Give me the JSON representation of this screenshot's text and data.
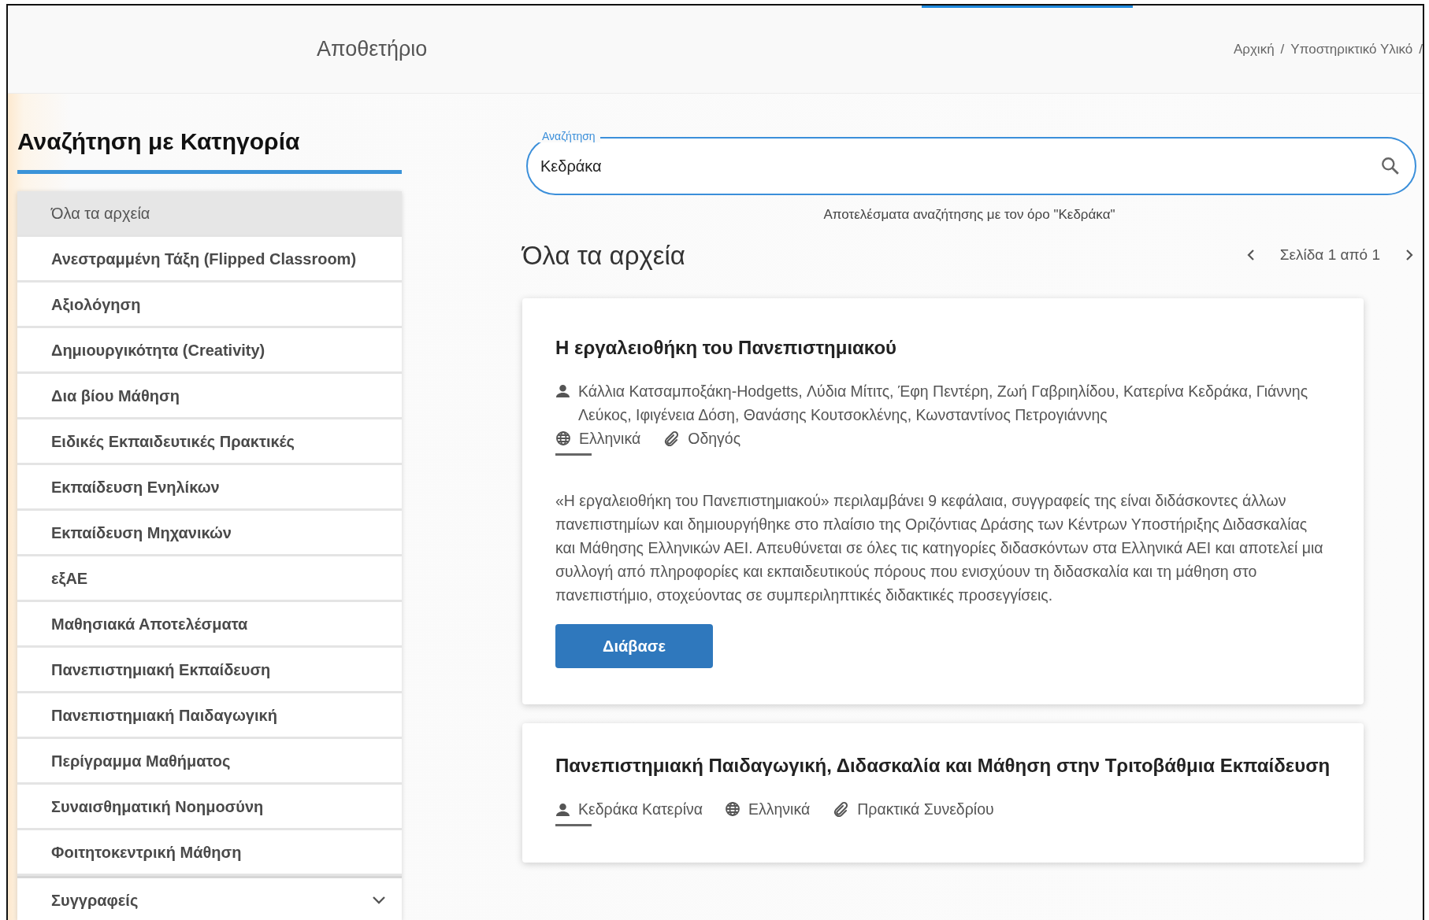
{
  "header": {
    "title": "Αποθετήριο",
    "breadcrumb": [
      {
        "label": "Αρχική",
        "separator": "/"
      },
      {
        "label": "Υποστηρικτικό Υλικό",
        "separator": "/"
      }
    ]
  },
  "sidebar": {
    "heading": "Αναζήτηση με Κατηγορία",
    "items": [
      {
        "label": "Όλα τα αρχεία",
        "selected": true
      },
      {
        "label": "Ανεστραμμένη Τάξη (Flipped Classroom)",
        "selected": false
      },
      {
        "label": "Αξιολόγηση",
        "selected": false
      },
      {
        "label": "Δημιουργικότητα (Creativity)",
        "selected": false
      },
      {
        "label": "Δια βίου Μάθηση",
        "selected": false
      },
      {
        "label": "Ειδικές Εκπαιδευτικές Πρακτικές",
        "selected": false
      },
      {
        "label": "Εκπαίδευση Ενηλίκων",
        "selected": false
      },
      {
        "label": "Εκπαίδευση Μηχανικών",
        "selected": false
      },
      {
        "label": "εξΑΕ",
        "selected": false
      },
      {
        "label": "Μαθησιακά Αποτελέσματα",
        "selected": false
      },
      {
        "label": "Πανεπιστημιακή Εκπαίδευση",
        "selected": false
      },
      {
        "label": "Πανεπιστημιακή Παιδαγωγική",
        "selected": false
      },
      {
        "label": "Περίγραμμα Μαθήματος",
        "selected": false
      },
      {
        "label": "Συναισθηματική Νοημοσύνη",
        "selected": false
      },
      {
        "label": "Φοιτητοκεντρική Μάθηση",
        "selected": false
      }
    ],
    "sections": [
      {
        "label": "Συγγραφείς",
        "expanded": false
      }
    ]
  },
  "search": {
    "label": "Αναζήτηση",
    "value": "Κεδράκα",
    "results_note": "Αποτελέσματα αναζήτησης με τον όρο \"Κεδράκα\""
  },
  "results": {
    "heading": "Όλα τα αρχεία",
    "pagination": "Σελίδα 1 από 1",
    "items": [
      {
        "title": "Η εργαλειοθήκη του Πανεπιστημιακού",
        "authors": "Κάλλια Κατσαμποξάκη-Hodgetts, Λύδια Μίτιτς, Έφη Πεντέρη, Ζωή Γαβριηλίδου, Κατερίνα Κεδράκα, Γιάννης Λεύκος, Ιφιγένεια Δόση, Θανάσης Κουτσοκλένης, Κωνσταντίνος Πετρογιάννης",
        "language": "Ελληνικά",
        "type": "Οδηγός",
        "description": "«Η εργαλειοθήκη του Πανεπιστημιακού» περιλαμβάνει 9 κεφάλαια, συγγραφείς της είναι διδάσκοντες άλλων πανεπιστημίων και δημιουργήθηκε στο πλαίσιο της Οριζόντιας Δράσης των Κέντρων Υποστήριξης Διδασκαλίας και Μάθησης Ελληνικών ΑΕΙ. Απευθύνεται σε όλες τις κατηγορίες διδασκόντων στα Ελληνικά ΑΕΙ και αποτελεί μια συλλογή από πληροφορίες και εκπαιδευτικούς πόρους που ενισχύουν τη διδασκαλία και τη μάθηση στο πανεπιστήμιο, στοχεύοντας σε συμπεριληπτικές διδακτικές προσεγγίσεις.",
        "button": "Διάβασε"
      },
      {
        "title": "Πανεπιστημιακή Παιδαγωγική, Διδασκαλία και Μάθηση στην Τριτοβάθμια Εκπαίδευση",
        "authors": "Κεδράκα Κατερίνα",
        "language": "Ελληνικά",
        "type": "Πρακτικά Συνεδρίου"
      }
    ]
  }
}
